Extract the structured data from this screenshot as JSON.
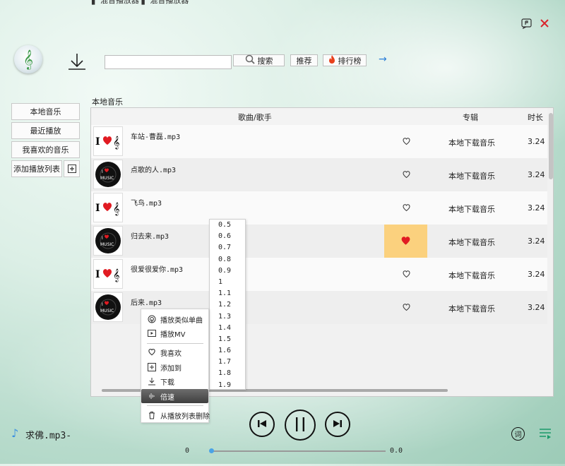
{
  "app": {
    "top_clipped_text": "▌ 混音播放器 ▌ 混音播放器"
  },
  "toolbar": {
    "search_value": "",
    "search_button": "搜索",
    "recommend_button": "推荐",
    "chart_button": "排行榜",
    "forward_arrow": "→"
  },
  "sidebar": {
    "items": [
      {
        "label": "本地音乐"
      },
      {
        "label": "最近播放"
      },
      {
        "label": "我喜欢的音乐"
      }
    ],
    "add_playlist_label": "添加播放列表",
    "add_icon": "plus-box-icon"
  },
  "main": {
    "section_title": "本地音乐",
    "columns": {
      "song": "歌曲/歌手",
      "album": "专辑",
      "duration": "时长"
    },
    "rows": [
      {
        "title": "车站-曹磊.mp3",
        "album": "本地下载音乐",
        "duration": "3.24",
        "liked": false,
        "thumb": "i-love-music-icon"
      },
      {
        "title": "点歌的人.mp3",
        "album": "本地下载音乐",
        "duration": "3.24",
        "liked": false,
        "thumb": "music-disc-icon"
      },
      {
        "title": "飞鸟.mp3",
        "album": "本地下载音乐",
        "duration": "3.24",
        "liked": false,
        "thumb": "i-love-music-icon"
      },
      {
        "title": "归去来.mp3",
        "album": "本地下载音乐",
        "duration": "3.24",
        "liked": true,
        "thumb": "music-disc-icon"
      },
      {
        "title": "很爱很爱你.mp3",
        "album": "本地下载音乐",
        "duration": "3.24",
        "liked": false,
        "thumb": "i-love-music-icon"
      },
      {
        "title": "后来.mp3",
        "album": "本地下载音乐",
        "duration": "3.24",
        "liked": false,
        "thumb": "music-disc-icon"
      }
    ]
  },
  "context_menu": {
    "items": [
      {
        "label": "播放类似单曲",
        "icon": "radar-icon"
      },
      {
        "label": "播放MV",
        "icon": "video-icon"
      },
      {
        "label": "我喜欢",
        "icon": "heart-icon"
      },
      {
        "label": "添加到",
        "icon": "plus-box-icon"
      },
      {
        "label": "下载",
        "icon": "download-icon"
      },
      {
        "label": "倍速",
        "icon": "waveform-icon",
        "selected": true
      },
      {
        "label": "从播放列表删除",
        "icon": "trash-icon"
      }
    ]
  },
  "speed_menu": {
    "options": [
      "0.5",
      "0.6",
      "0.7",
      "0.8",
      "0.9",
      "1",
      "1.1",
      "1.2",
      "1.3",
      "1.4",
      "1.5",
      "1.6",
      "1.7",
      "1.8",
      "1.9"
    ]
  },
  "player": {
    "now_playing": "求佛.mp3-",
    "current_time": "0",
    "total_time": "0.0",
    "progress": 0,
    "lyrics_label": "词"
  },
  "colors": {
    "accent_blue": "#2a7ed8",
    "liked_red": "#e11b22",
    "liked_cell_bg": "#fbd17e",
    "close_red": "#d9262c"
  }
}
